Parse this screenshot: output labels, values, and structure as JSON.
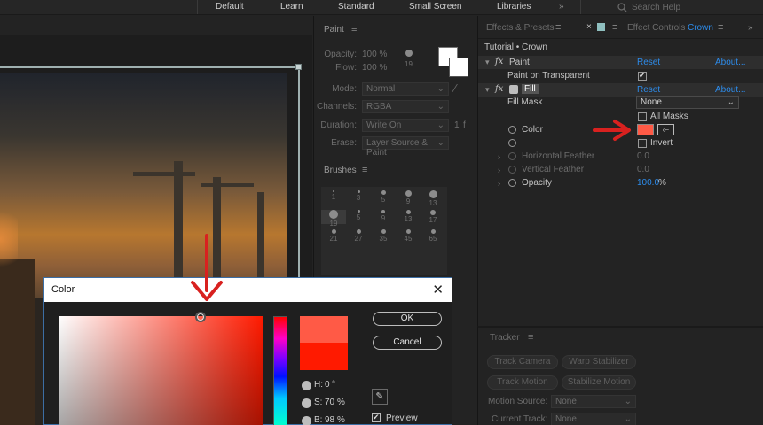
{
  "workspaces": [
    "Default",
    "Learn",
    "Standard",
    "Small Screen",
    "Libraries"
  ],
  "search": {
    "placeholder": "Search Help"
  },
  "paint": {
    "title": "Paint",
    "opacity_label": "Opacity:",
    "opacity_value": "100 %",
    "flow_label": "Flow:",
    "flow_value": "100 %",
    "brush_size": "19",
    "mode_label": "Mode:",
    "mode_value": "Normal",
    "channels_label": "Channels:",
    "channels_value": "RGBA",
    "duration_label": "Duration:",
    "duration_value": "Write On",
    "duration_num": "1",
    "duration_unit": "f",
    "erase_label": "Erase:",
    "erase_value": "Layer Source & Paint"
  },
  "brushes": {
    "title": "Brushes",
    "items": [
      {
        "num": "1",
        "d": 2
      },
      {
        "num": "3",
        "d": 3
      },
      {
        "num": "5",
        "d": 5
      },
      {
        "num": "9",
        "d": 7
      },
      {
        "num": "13",
        "d": 9
      },
      {
        "num": "19",
        "d": 10
      },
      {
        "num": "5",
        "d": 3
      },
      {
        "num": "9",
        "d": 4
      },
      {
        "num": "13",
        "d": 5
      },
      {
        "num": "17",
        "d": 6
      },
      {
        "num": "21",
        "d": 5
      },
      {
        "num": "27",
        "d": 5
      },
      {
        "num": "35",
        "d": 5
      },
      {
        "num": "45",
        "d": 5
      },
      {
        "num": "65",
        "d": 5
      }
    ]
  },
  "effects": {
    "tab_effects": "Effects & Presets",
    "tab_controls": "Effect Controls",
    "tab_layer": "Crown",
    "comp_label": "Tutorial • Crown",
    "paint_name": "Paint",
    "reset": "Reset",
    "about": "About...",
    "paint_on_transparent": "Paint on Transparent",
    "fill_name": "Fill",
    "fill_mask_label": "Fill Mask",
    "fill_mask_value": "None",
    "all_masks": "All Masks",
    "color_label": "Color",
    "invert": "Invert",
    "h_feather": "Horizontal Feather",
    "h_feather_val": "0.0",
    "v_feather": "Vertical Feather",
    "v_feather_val": "0.0",
    "opacity_label": "Opacity",
    "opacity_val": "100.0",
    "opacity_unit": "%",
    "fill_color": "#ff5a46"
  },
  "tracker": {
    "title": "Tracker",
    "track_camera": "Track Camera",
    "warp_stabilizer": "Warp Stabilizer",
    "track_motion": "Track Motion",
    "stabilize_motion": "Stabilize Motion",
    "motion_source_label": "Motion Source:",
    "motion_source_value": "None",
    "current_track_label": "Current Track:",
    "current_track_value": "None"
  },
  "color_dialog": {
    "title": "Color",
    "ok": "OK",
    "cancel": "Cancel",
    "h_label": "H:",
    "h_value": "0",
    "h_unit": "°",
    "s_label": "S:",
    "s_value": "70",
    "s_unit": "%",
    "b_label": "B:",
    "b_value": "98",
    "b_unit": "%",
    "preview": "Preview",
    "new_color": "#ff5a46",
    "current_color": "#ff1a00"
  }
}
